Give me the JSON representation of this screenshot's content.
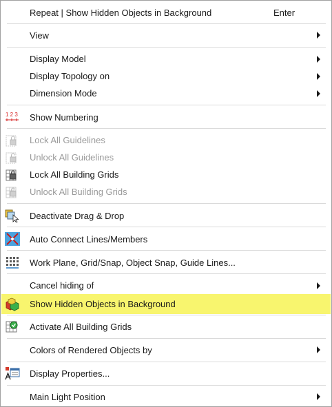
{
  "menu": {
    "repeat": {
      "label": "Repeat | Show Hidden Objects in Background",
      "shortcut": "Enter"
    },
    "view": {
      "label": "View"
    },
    "display_model": {
      "label": "Display Model"
    },
    "display_topology": {
      "label": "Display Topology on"
    },
    "dimension_mode": {
      "label": "Dimension Mode"
    },
    "show_numbering": {
      "label": "Show Numbering",
      "icon": "numbering-icon",
      "icon_text": "1 2 3"
    },
    "lock_guidelines": {
      "label": "Lock All Guidelines",
      "icon": "lock-guidelines-icon",
      "disabled": true
    },
    "unlock_guidelines": {
      "label": "Unlock All Guidelines",
      "icon": "unlock-guidelines-icon",
      "disabled": true
    },
    "lock_grids": {
      "label": "Lock All Building Grids",
      "icon": "lock-grids-icon"
    },
    "unlock_grids": {
      "label": "Unlock All Building Grids",
      "icon": "unlock-grids-icon",
      "disabled": true
    },
    "deactivate_dnd": {
      "label": "Deactivate Drag & Drop",
      "icon": "drag-drop-icon"
    },
    "auto_connect": {
      "label": "Auto Connect Lines/Members",
      "icon": "auto-connect-icon"
    },
    "work_plane": {
      "label": "Work Plane, Grid/Snap, Object Snap, Guide Lines...",
      "icon": "work-plane-icon"
    },
    "cancel_hiding": {
      "label": "Cancel hiding of"
    },
    "show_hidden": {
      "label": "Show Hidden Objects in Background",
      "icon": "hidden-objects-icon",
      "highlighted": true
    },
    "activate_grids": {
      "label": "Activate All Building Grids",
      "icon": "activate-grids-icon"
    },
    "colors_rendered": {
      "label": "Colors of Rendered Objects by"
    },
    "display_properties": {
      "label": "Display Properties...",
      "icon": "display-properties-icon"
    },
    "main_light": {
      "label": "Main Light Position"
    }
  },
  "colors": {
    "highlight": "#f8f56e",
    "disabled_text": "#9a9a9a",
    "separator": "#dadada",
    "accent": "#4aa3df"
  }
}
